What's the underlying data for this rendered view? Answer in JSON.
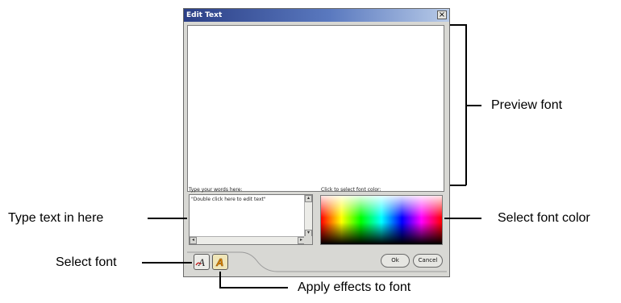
{
  "dialog": {
    "title": "Edit Text",
    "close_glyph": "×",
    "type_label": "Type your words here:",
    "text_value": "\"Double click here to edit text\"",
    "color_label": "Click to select font color:",
    "ok_label": "Ok",
    "cancel_label": "Cancel",
    "font_button_icon": "font-icon",
    "effects_button_icon": "font-effects-icon"
  },
  "callouts": {
    "preview_font": "Preview font",
    "type_text": "Type text in here",
    "select_font_color": "Select font color",
    "select_font": "Select font",
    "apply_effects": "Apply effects to font"
  }
}
